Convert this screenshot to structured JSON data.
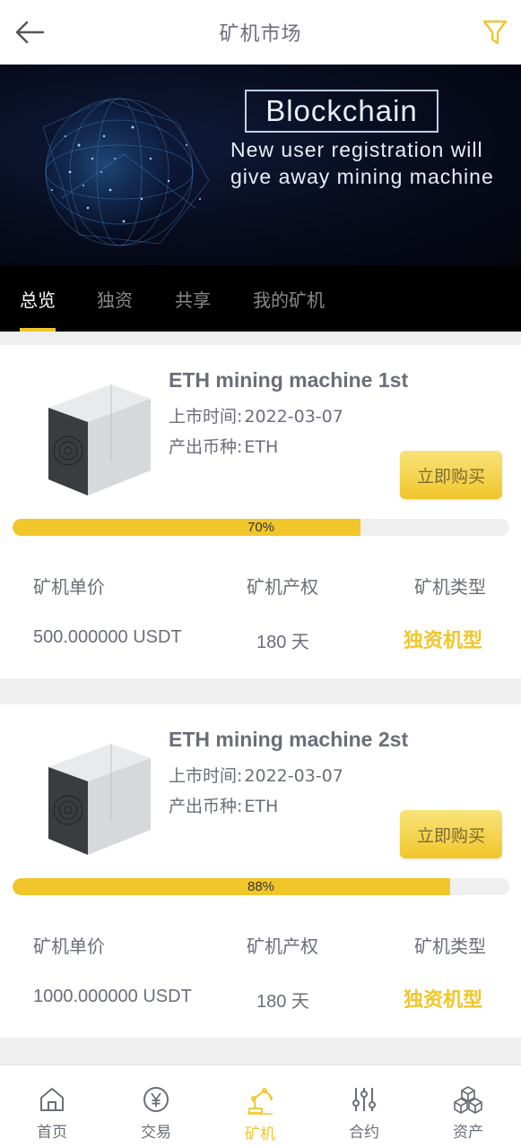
{
  "header": {
    "title": "矿机市场"
  },
  "banner": {
    "heading": "Blockchain",
    "text": "New user registration will give away mining machine"
  },
  "tabs": [
    {
      "label": "总览",
      "active": true
    },
    {
      "label": "独资",
      "active": false
    },
    {
      "label": "共享",
      "active": false
    },
    {
      "label": "我的矿机",
      "active": false
    }
  ],
  "machines": [
    {
      "name": "ETH mining machine 1st",
      "listing_label": "上市时间:",
      "listing_date": "2022-03-07",
      "coin_label": "产出币种:",
      "coin": "ETH",
      "buy_label": "立即购买",
      "progress": 0.7,
      "progress_text": "70%",
      "price_label": "矿机单价",
      "term_label": "矿机产权",
      "type_label": "矿机类型",
      "price": "500.000000 USDT",
      "term": "180 天",
      "type": "独资机型"
    },
    {
      "name": "ETH mining machine 2st",
      "listing_label": "上市时间:",
      "listing_date": "2022-03-07",
      "coin_label": "产出币种:",
      "coin": "ETH",
      "buy_label": "立即购买",
      "progress": 0.88,
      "progress_text": "88%",
      "price_label": "矿机单价",
      "term_label": "矿机产权",
      "type_label": "矿机类型",
      "price": "1000.000000 USDT",
      "term": "180 天",
      "type": "独资机型"
    }
  ],
  "bottom_nav": [
    {
      "label": "首页",
      "icon": "home-icon",
      "active": false
    },
    {
      "label": "交易",
      "icon": "yen-icon",
      "active": false
    },
    {
      "label": "矿机",
      "icon": "robot-arm-icon",
      "active": true
    },
    {
      "label": "合约",
      "icon": "sliders-icon",
      "active": false
    },
    {
      "label": "资产",
      "icon": "cubes-icon",
      "active": false
    }
  ],
  "colors": {
    "accent": "#f1c62a",
    "text": "#6b6e78",
    "banner_bg": "#070b1c"
  }
}
